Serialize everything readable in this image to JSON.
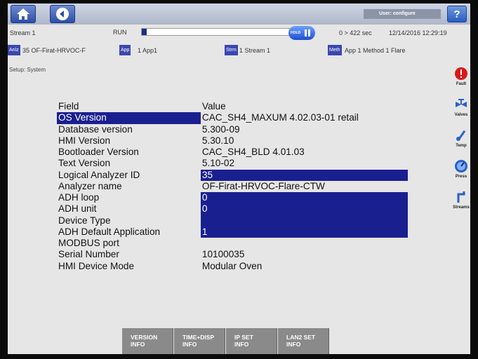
{
  "topbar": {
    "home_icon": "home-icon",
    "back_icon": "back-arrow-icon",
    "user_label": "User: configure",
    "help_label": "?"
  },
  "status": {
    "stream_name": "Stream 1",
    "run_label": "RUN",
    "progress_fraction": 0.03,
    "hold_label": "HOLD",
    "timer": "0 > 422 sec",
    "datetime": "12/14/2016 12:29:19"
  },
  "info": {
    "analyzer_tag": "Anlz",
    "analyzer_value": "35 OF-Firat-HRVOC-F",
    "app_tag": "App",
    "app_value": "1 App1",
    "stream_tag": "Strm",
    "stream_value": "1 Stream 1",
    "method_tag": "Meth",
    "method_value": "App 1 Method 1 Flare"
  },
  "breadcrumb": "Setup: System",
  "sidebar": [
    {
      "label": "Fault",
      "icon": "fault-icon"
    },
    {
      "label": "Valves",
      "icon": "valves-icon"
    },
    {
      "label": "Temp",
      "icon": "thermometer-icon"
    },
    {
      "label": "Press",
      "icon": "pressure-gauge-icon"
    },
    {
      "label": "Streams",
      "icon": "streams-icon"
    }
  ],
  "table": {
    "header_field": "Field",
    "header_value": "Value",
    "rows": [
      {
        "field": "OS Version",
        "value": "CAC_SH4_MAXUM 4.02.03-01 retail"
      },
      {
        "field": "Database version",
        "value": "5.300-09"
      },
      {
        "field": "HMI Version",
        "value": "5.30.10"
      },
      {
        "field": "Bootloader Version",
        "value": "CAC_SH4_BLD 4.01.03"
      },
      {
        "field": "Text Version",
        "value": "5.10-02"
      },
      {
        "field": "Logical Analyzer ID",
        "value": "35"
      },
      {
        "field": "Analyzer name",
        "value": "OF-Firat-HRVOC-Flare-CTW"
      },
      {
        "field": "ADH loop",
        "value": "0"
      },
      {
        "field": "ADH unit",
        "value": "0"
      },
      {
        "field": "Device Type",
        "value": ""
      },
      {
        "field": "ADH Default Application",
        "value": "1"
      },
      {
        "field": "MODBUS port",
        "value": ""
      },
      {
        "field": "Serial Number",
        "value": "10100035"
      },
      {
        "field": "HMI Device Mode",
        "value": "Modular Oven"
      }
    ]
  },
  "softkeys": [
    {
      "line1": "VERSION",
      "line2": "INFO"
    },
    {
      "line1": "TIME+DISP",
      "line2": "INFO"
    },
    {
      "line1": "IP SET",
      "line2": "INFO"
    },
    {
      "line1": "LAN2 SET",
      "line2": "INFO"
    }
  ],
  "colors": {
    "selection": "#1a1f90",
    "tag": "#3a47b0",
    "softkey": "#8a8a8a"
  }
}
